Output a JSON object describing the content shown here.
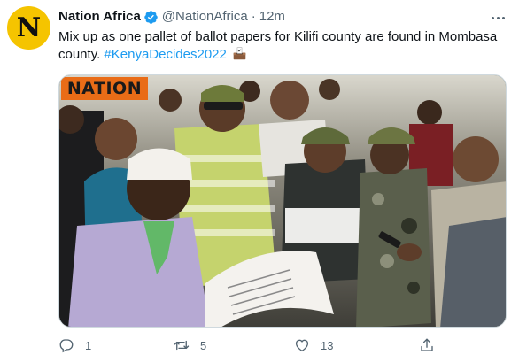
{
  "tweet": {
    "avatar_letter": "N",
    "display_name": "Nation Africa",
    "handle": "@NationAfrica",
    "separator": "·",
    "time": "12m",
    "text_main": "Mix up as one pallet of ballot papers for Kilifi county are found in Mombasa county.",
    "hashtag": "#KenyaDecides2022",
    "emoji": "ballot-box-emoji",
    "more_icon": "more-dots-icon"
  },
  "media": {
    "logo_text": "NATION"
  },
  "actions": {
    "reply": {
      "icon": "reply-icon",
      "count": "1"
    },
    "retweet": {
      "icon": "retweet-icon",
      "count": "5"
    },
    "like": {
      "icon": "heart-icon",
      "count": "13"
    },
    "share": {
      "icon": "share-icon"
    }
  },
  "colors": {
    "accent": "#1d9bf0",
    "avatar_bg": "#f5c400",
    "muted": "#536471",
    "logo_bg": "#e96c17"
  }
}
